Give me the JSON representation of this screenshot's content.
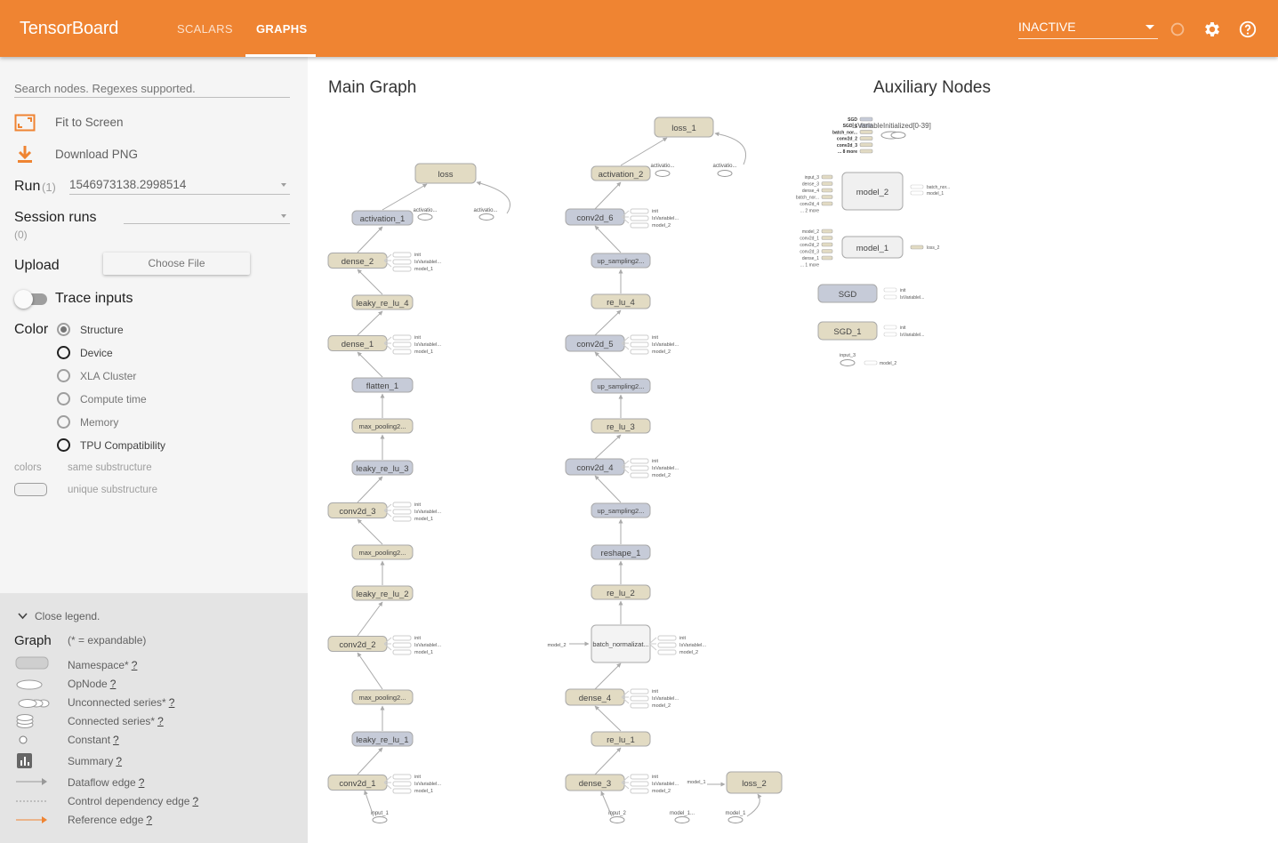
{
  "topbar": {
    "brand": "TensorBoard",
    "tabs": [
      {
        "label": "SCALARS"
      },
      {
        "label": "GRAPHS",
        "active": true
      }
    ],
    "run_status": "INACTIVE",
    "icons": [
      "refresh-icon",
      "settings-icon",
      "help-icon"
    ],
    "color": "#ef8432"
  },
  "sidebar": {
    "search_placeholder": "Search nodes. Regexes supported.",
    "fit_label": "Fit to Screen",
    "download_label": "Download PNG",
    "run_label": "Run",
    "run_count": "(1)",
    "run_value": "1546973138.2998514",
    "session_label": "Session runs",
    "session_count": "(0)",
    "upload_label": "Upload",
    "choose_file": "Choose File",
    "trace_label": "Trace inputs",
    "color_label": "Color",
    "color_options": [
      "Structure",
      "Device",
      "XLA Cluster",
      "Compute time",
      "Memory",
      "TPU Compatibility"
    ],
    "color_selected": "Structure",
    "colors_label": "colors",
    "same_sub": "same substructure",
    "unique_sub": "unique substructure"
  },
  "legend": {
    "close": "Close legend.",
    "graph_label": "Graph",
    "expandable_note": "(* = expandable)",
    "q": "?",
    "items": [
      "Namespace*",
      "OpNode",
      "Unconnected series*",
      "Connected series*",
      "Constant",
      "Summary",
      "Dataflow edge",
      "Control dependency edge",
      "Reference edge"
    ]
  },
  "graph": {
    "main_title": "Main Graph",
    "aux_title": "Auxiliary Nodes",
    "colors": {
      "tan": "#e2dbc3",
      "blue": "#c6cbd8",
      "white": "#f3f3f3",
      "edge": "#aaaaaa"
    },
    "col1": [
      {
        "name": "loss",
        "c": "tan"
      },
      {
        "name": "activation_1",
        "c": "blue"
      },
      {
        "name": "dense_2",
        "c": "tan",
        "ref": true
      },
      {
        "name": "leaky_re_lu_4",
        "c": "tan"
      },
      {
        "name": "dense_1",
        "c": "tan",
        "ref": true
      },
      {
        "name": "flatten_1",
        "c": "blue"
      },
      {
        "name": "max_pooling2...",
        "c": "tan"
      },
      {
        "name": "leaky_re_lu_3",
        "c": "blue"
      },
      {
        "name": "conv2d_3",
        "c": "tan",
        "ref": true
      },
      {
        "name": "max_pooling2...",
        "c": "tan"
      },
      {
        "name": "leaky_re_lu_2",
        "c": "tan"
      },
      {
        "name": "conv2d_2",
        "c": "tan",
        "ref": true
      },
      {
        "name": "max_pooling2...",
        "c": "tan"
      },
      {
        "name": "leaky_re_lu_1",
        "c": "blue"
      },
      {
        "name": "conv2d_1",
        "c": "tan",
        "ref": true
      }
    ],
    "col2": [
      {
        "name": "loss_1",
        "c": "tan"
      },
      {
        "name": "activation_2",
        "c": "tan"
      },
      {
        "name": "conv2d_6",
        "c": "blue",
        "ref": true
      },
      {
        "name": "up_sampling2...",
        "c": "blue"
      },
      {
        "name": "re_lu_4",
        "c": "tan"
      },
      {
        "name": "conv2d_5",
        "c": "blue",
        "ref": true
      },
      {
        "name": "up_sampling2...",
        "c": "blue"
      },
      {
        "name": "re_lu_3",
        "c": "tan"
      },
      {
        "name": "conv2d_4",
        "c": "blue",
        "ref": true
      },
      {
        "name": "up_sampling2...",
        "c": "blue"
      },
      {
        "name": "reshape_1",
        "c": "blue"
      },
      {
        "name": "re_lu_2",
        "c": "tan"
      },
      {
        "name": "batch_normalizat...",
        "c": "white",
        "ref": true
      },
      {
        "name": "dense_4",
        "c": "tan",
        "ref": true
      },
      {
        "name": "re_lu_1",
        "c": "tan"
      },
      {
        "name": "dense_3",
        "c": "tan",
        "ref": true
      }
    ],
    "ref_labels": [
      "init",
      "IsVariableI...",
      "model_1"
    ],
    "ref_labels2": [
      "init",
      "IsVariableI...",
      "model_2"
    ],
    "small_labels": {
      "activation": "activatio...",
      "input_1": "input_1",
      "input_2": "input_2",
      "model_1": "model_1",
      "model_1b": "model_1...",
      "model_2": "model_2",
      "loss_2": "loss_2"
    },
    "aux": {
      "top_label": "IsVariableInitialized[0-39]",
      "top_stack": [
        "SGD",
        "SGD_1",
        "batch_nor...",
        "conv2d_2",
        "conv2d_3",
        "... 8 more"
      ],
      "model_2": {
        "name": "model_2",
        "inputs": [
          "input_3",
          "dense_3",
          "dense_4",
          "batch_nor...",
          "conv2d_4",
          "... 2 more"
        ],
        "outputs": [
          "batch_nor...",
          "model_1"
        ]
      },
      "model_1": {
        "name": "model_1",
        "inputs": [
          "model_2",
          "conv2d_1",
          "conv2d_2",
          "conv2d_3",
          "dense_1",
          "... 1 more"
        ],
        "outputs": [
          "loss_2"
        ]
      },
      "sgd": {
        "name": "SGD",
        "outputs": [
          "init",
          "IsVariableI..."
        ]
      },
      "sgd_1": {
        "name": "SGD_1",
        "outputs": [
          "init",
          "IsVariableI..."
        ]
      },
      "input_3": {
        "name": "input_3",
        "outputs": [
          "model_2"
        ]
      }
    }
  }
}
